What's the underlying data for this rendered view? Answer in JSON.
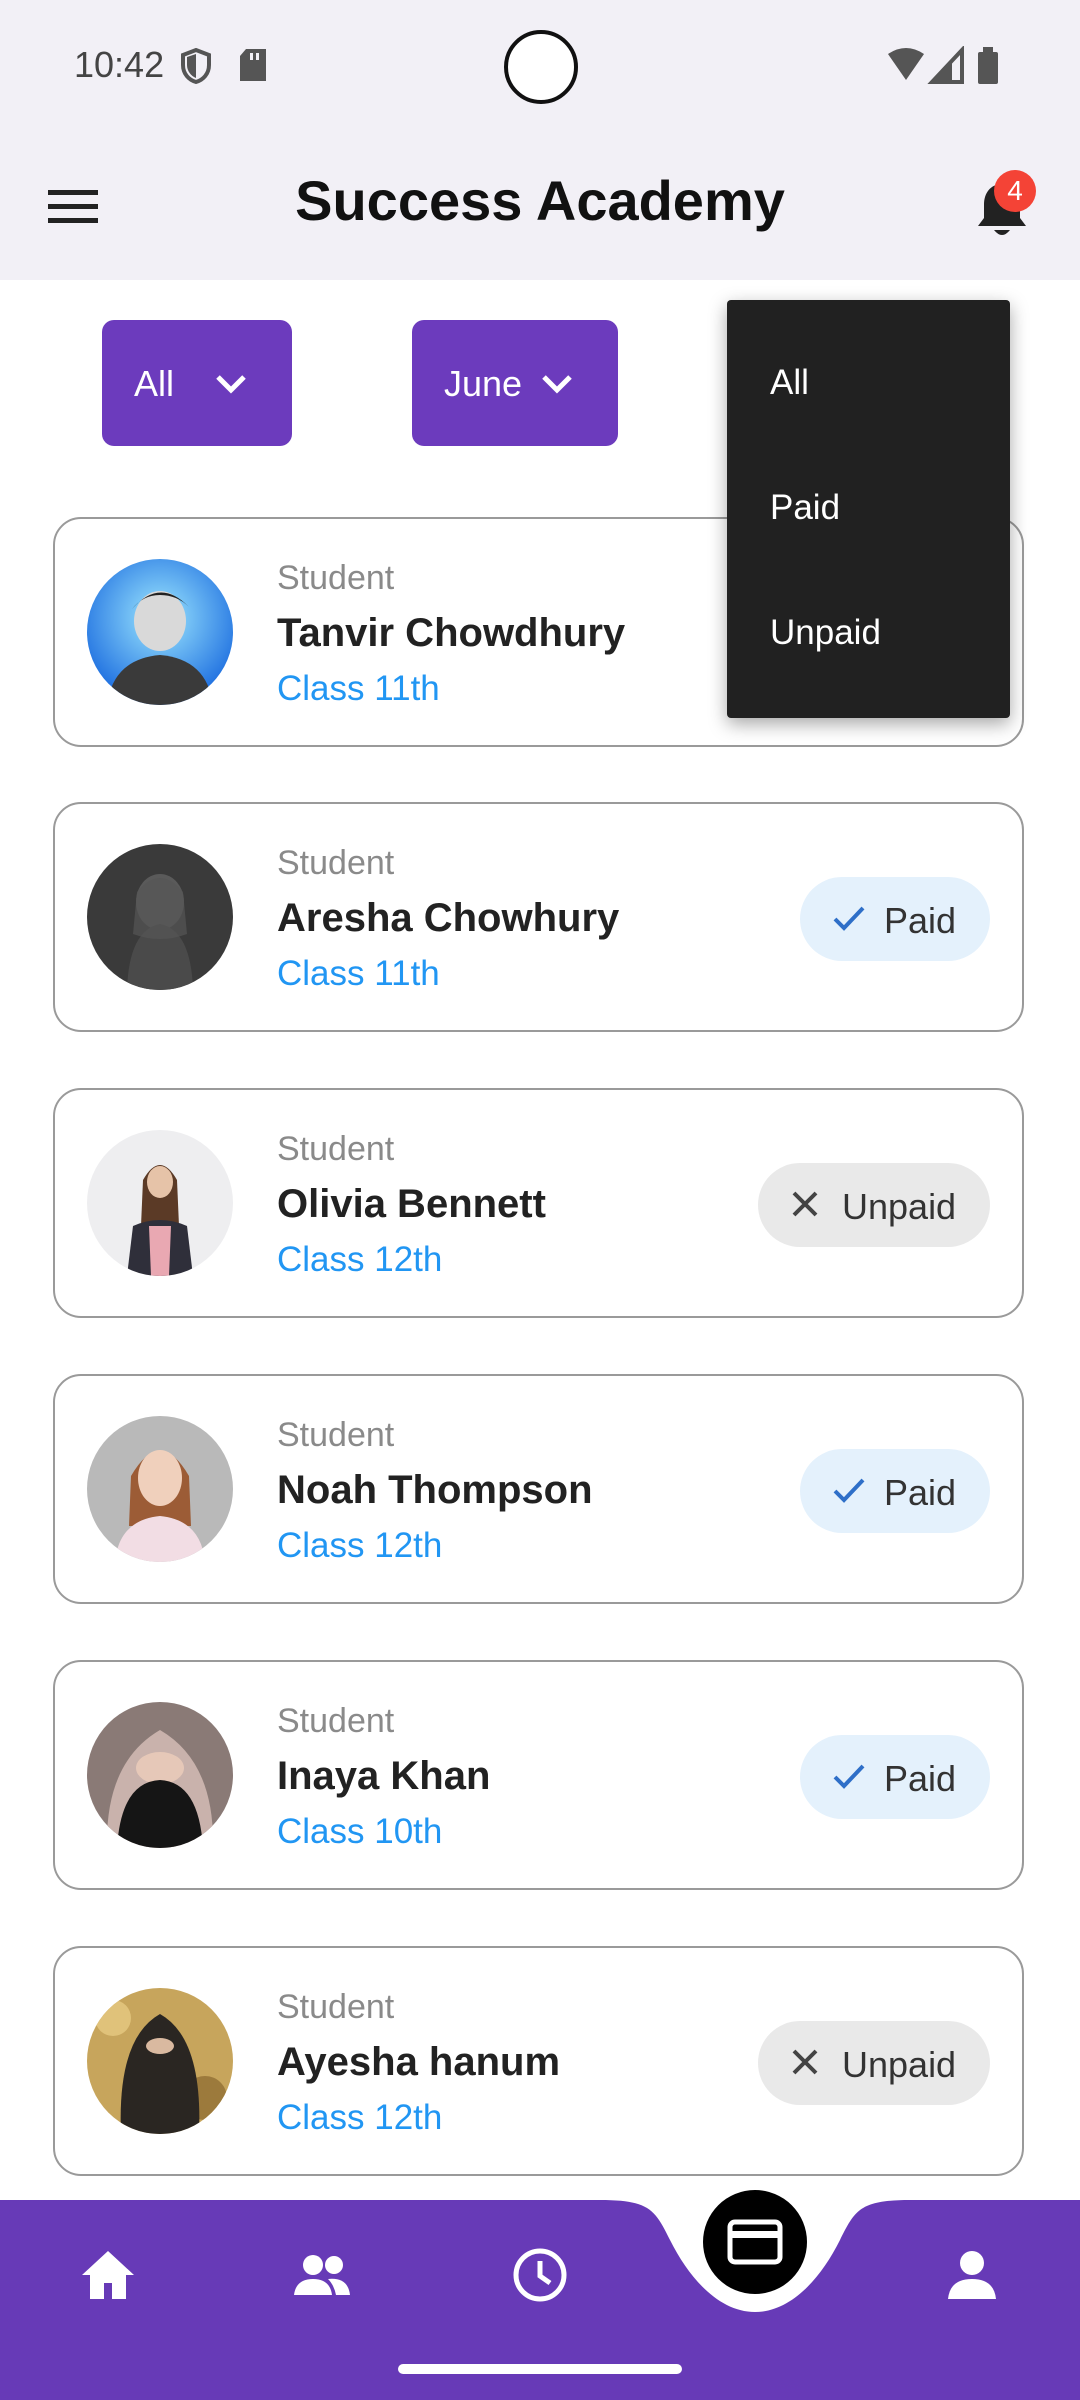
{
  "status_bar": {
    "time": "10:42"
  },
  "app_bar": {
    "title": "Success Academy",
    "notification_count": "4"
  },
  "filters": {
    "class_filter": "All",
    "month_filter": "June"
  },
  "status_menu": {
    "items": [
      "All",
      "Paid",
      "Unpaid"
    ]
  },
  "students": [
    {
      "role": "Student",
      "name": "Tanvir Chowdhury",
      "class": "Class 11th",
      "status": "",
      "status_label": ""
    },
    {
      "role": "Student",
      "name": "Aresha Chowhury",
      "class": "Class 11th",
      "status": "paid",
      "status_label": "Paid"
    },
    {
      "role": "Student",
      "name": "Olivia Bennett",
      "class": "Class 12th",
      "status": "unpaid",
      "status_label": "Unpaid"
    },
    {
      "role": "Student",
      "name": "Noah Thompson",
      "class": "Class 12th",
      "status": "paid",
      "status_label": "Paid"
    },
    {
      "role": "Student",
      "name": "Inaya Khan",
      "class": "Class 10th",
      "status": "paid",
      "status_label": "Paid"
    },
    {
      "role": "Student",
      "name": "Ayesha hanum",
      "class": "Class 12th",
      "status": "unpaid",
      "status_label": "Unpaid"
    }
  ],
  "bottom_nav": {
    "items": [
      "home-icon",
      "people-icon",
      "history-icon",
      "payment-icon",
      "profile-icon"
    ],
    "active": "payment-icon"
  },
  "colors": {
    "primary": "#6c3bbd",
    "nav": "#673ab7",
    "link": "#2196f3",
    "paid_chip": "#e4f1fc",
    "unpaid_chip": "#e9e9e9",
    "badge": "#f44336"
  }
}
